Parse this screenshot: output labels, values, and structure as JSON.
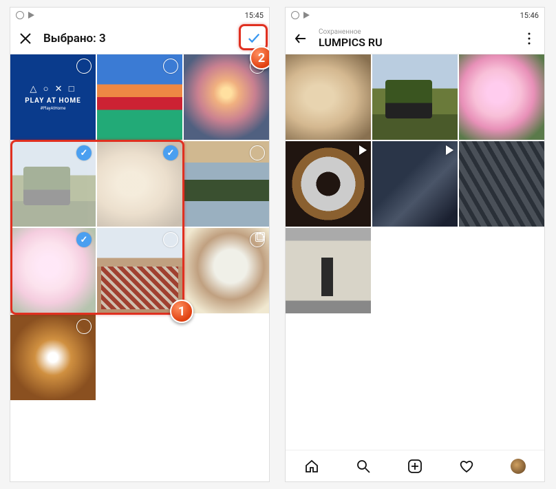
{
  "left": {
    "status_time": "15:45",
    "title": "Выбрано: 3",
    "playhome": {
      "shapes": "△ ○ ✕ □",
      "text": "PLAY AT HOME",
      "sub": "#PlayAtHome"
    },
    "tiles": [
      {
        "name": "playhome",
        "selected": false
      },
      {
        "name": "tulips",
        "selected": false
      },
      {
        "name": "sunset",
        "selected": false
      },
      {
        "name": "tractor",
        "selected": true
      },
      {
        "name": "shells",
        "selected": true
      },
      {
        "name": "lake",
        "selected": false
      },
      {
        "name": "rose",
        "selected": true
      },
      {
        "name": "village",
        "selected": false
      },
      {
        "name": "cat",
        "selected": false,
        "carousel": true
      },
      {
        "name": "leaves",
        "selected": false
      }
    ]
  },
  "right": {
    "status_time": "15:46",
    "subtitle": "Сохраненное",
    "title": "LUMPICS RU",
    "tiles": [
      {
        "name": "shells"
      },
      {
        "name": "tractor"
      },
      {
        "name": "rose"
      },
      {
        "name": "wreath",
        "video": true
      },
      {
        "name": "warrior",
        "video": true
      },
      {
        "name": "city"
      },
      {
        "name": "hall"
      }
    ]
  },
  "callouts": {
    "one": "1",
    "two": "2"
  }
}
